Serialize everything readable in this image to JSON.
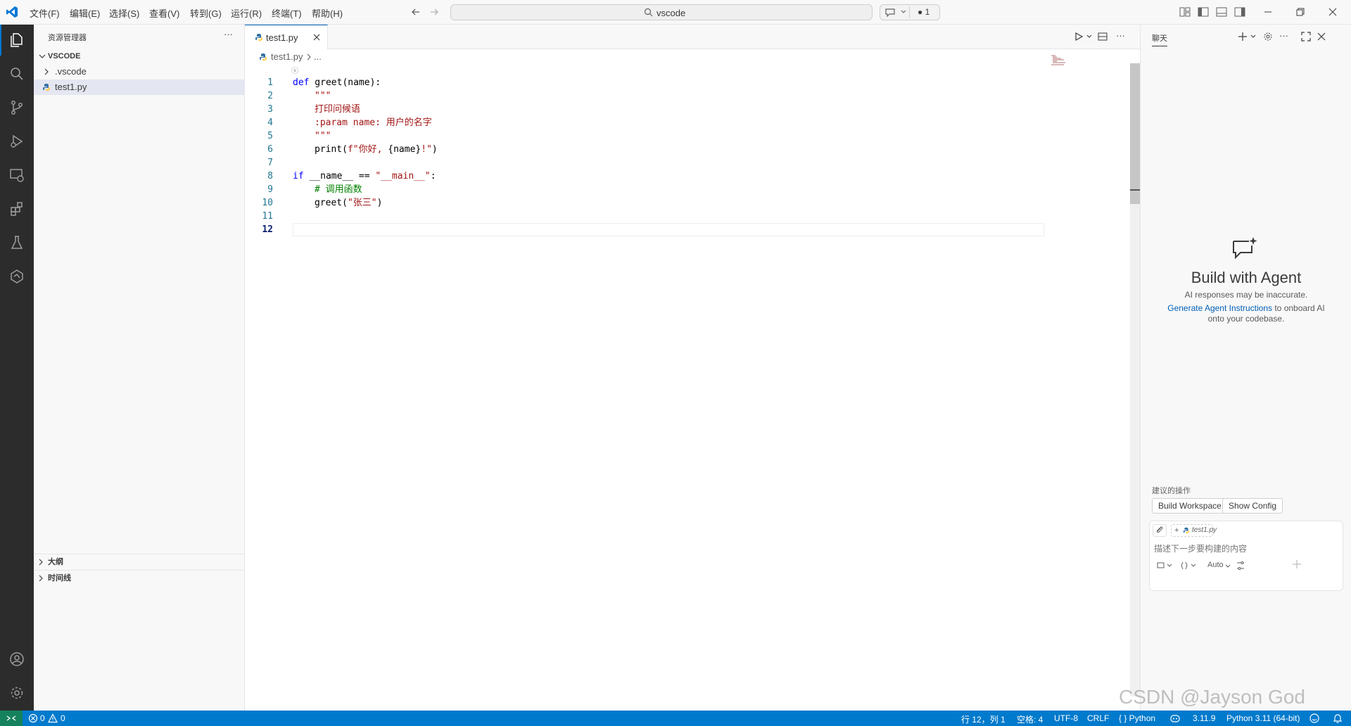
{
  "titlebar": {
    "menus": [
      "文件(F)",
      "编辑(E)",
      "选择(S)",
      "查看(V)",
      "转到(G)",
      "运行(R)",
      "终端(T)",
      "帮助(H)"
    ],
    "search_text": "vscode",
    "badge_count": "● 1"
  },
  "sidebar": {
    "title": "资源管理器",
    "more": "···",
    "root": "VSCODE",
    "items": [
      ".vscode",
      "test1.py"
    ],
    "outline": "大纲",
    "timeline": "时间线"
  },
  "editor": {
    "tab_label": "test1.py",
    "breadcrumb_file": "test1.py",
    "breadcrumb_more": "...",
    "codelens": "ⓢ",
    "line_numbers": [
      "1",
      "2",
      "3",
      "4",
      "5",
      "6",
      "7",
      "8",
      "9",
      "10",
      "11",
      "12"
    ],
    "code": {
      "l1_kw": "def",
      "l1_rest": " greet(name):",
      "l2": "\"\"\"",
      "l3": "打印问候语",
      "l4": ":param name: 用户的名字",
      "l5": "\"\"\"",
      "l6_a": "print(",
      "l6_b": "f\"你好, ",
      "l6_c": "{name}",
      "l6_d": "!\"",
      "l6_e": ")",
      "l8_kw": "if",
      "l8_a": " __name__ == ",
      "l8_b": "\"__main__\"",
      "l8_c": ":",
      "l9": "# 调用函数",
      "l10_a": "greet(",
      "l10_b": "\"张三\"",
      "l10_c": ")"
    }
  },
  "chat": {
    "tab": "聊天",
    "heading": "Build with Agent",
    "disclaimer": "AI responses may be inaccurate.",
    "link": "Generate Agent Instructions",
    "link_after": " to onboard AI",
    "line2": "onto your codebase.",
    "suggested_label": "建议的操作",
    "btn_workspace": "Build Workspace",
    "btn_config": "Show Config",
    "context_file": "test1.py",
    "input_placeholder": "描述下一步要构建的内容",
    "mode": "Auto"
  },
  "status": {
    "errors": "0",
    "warnings": "0",
    "position": "行 12，列 1",
    "spaces": "空格: 4",
    "encoding": "UTF-8",
    "eol": "CRLF",
    "language": "{ } Python",
    "version": "3.11.9",
    "interpreter": "Python 3.11 (64-bit)",
    "watermark": "CSDN @Jayson God"
  },
  "colors": {
    "accent": "#005fb8",
    "statusbar": "#007acc",
    "keyword": "#0000ff",
    "string": "#a31515",
    "comment": "#008000"
  }
}
